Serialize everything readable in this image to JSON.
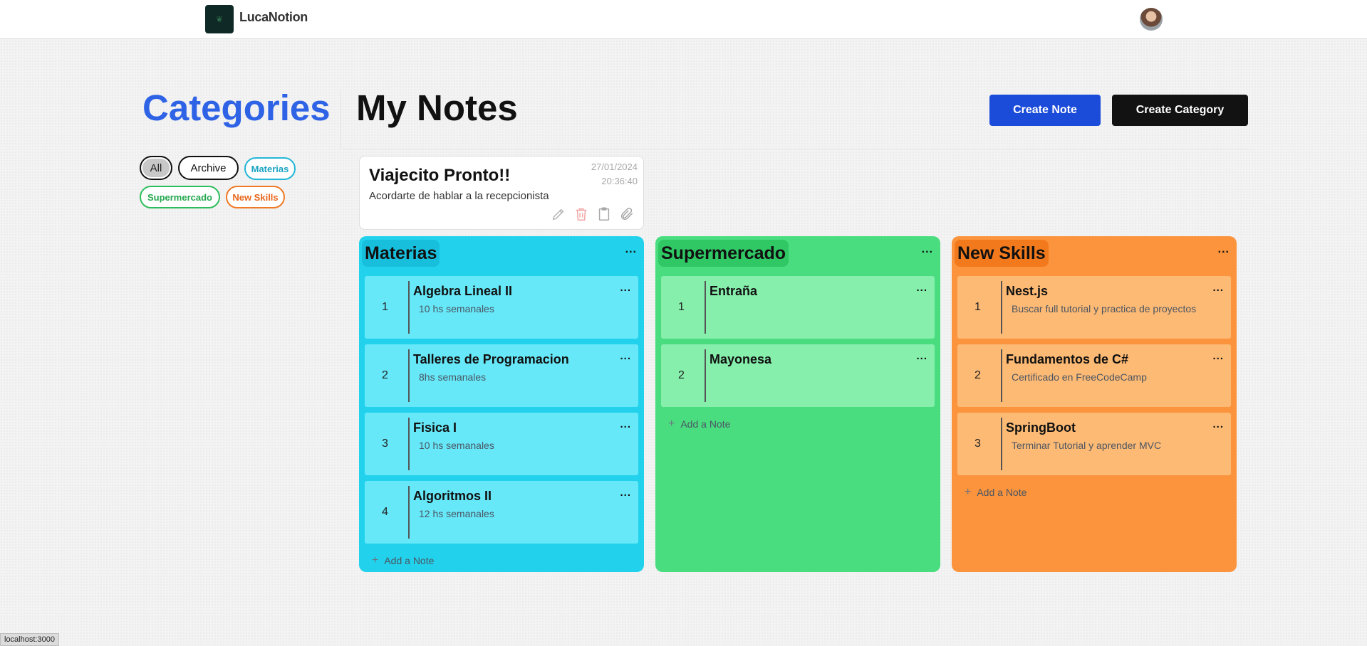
{
  "app": {
    "name": "LucaNotion",
    "logo_icon": "leaf-logo-icon",
    "avatar_icon": "user-avatar"
  },
  "headings": {
    "categories": "Categories",
    "my_notes": "My Notes"
  },
  "buttons": {
    "create_note": "Create Note",
    "create_category": "Create Category"
  },
  "filters": [
    "All",
    "Archive",
    "Materias",
    "Supermercado",
    "New Skills"
  ],
  "note": {
    "title": "Viajecito Pronto!!",
    "description": "Acordarte de hablar a la recepcionista",
    "date": "27/01/2024",
    "time": "20:36:40",
    "actions": [
      "pencil-icon",
      "trash-icon",
      "clipboard-icon",
      "paperclip-icon"
    ]
  },
  "columns": [
    {
      "name": "Materias",
      "color": "#22d2ec",
      "menu": "...",
      "add_label": "Add a Note",
      "items": [
        {
          "num": "1",
          "title": "Algebra Lineal II",
          "desc": "10 hs semanales"
        },
        {
          "num": "2",
          "title": "Talleres de Programacion",
          "desc": "8hs semanales"
        },
        {
          "num": "3",
          "title": "Fisica I",
          "desc": "10 hs semanales"
        },
        {
          "num": "4",
          "title": "Algoritmos II",
          "desc": "12 hs semanales"
        }
      ]
    },
    {
      "name": "Supermercado",
      "color": "#4add80",
      "menu": "...",
      "add_label": "Add a Note",
      "items": [
        {
          "num": "1",
          "title": "Entraña",
          "desc": ""
        },
        {
          "num": "2",
          "title": "Mayonesa",
          "desc": ""
        }
      ]
    },
    {
      "name": "New Skills",
      "color": "#fb943c",
      "menu": "...",
      "add_label": "Add a Note",
      "items": [
        {
          "num": "1",
          "title": "Nest.js",
          "desc": "Buscar full tutorial y practica de proyectos"
        },
        {
          "num": "2",
          "title": "Fundamentos de C#",
          "desc": "Certificado en FreeCodeCamp"
        },
        {
          "num": "3",
          "title": "SpringBoot",
          "desc": "Terminar Tutorial y aprender MVC"
        }
      ]
    }
  ],
  "status_bar": "localhost:3000"
}
